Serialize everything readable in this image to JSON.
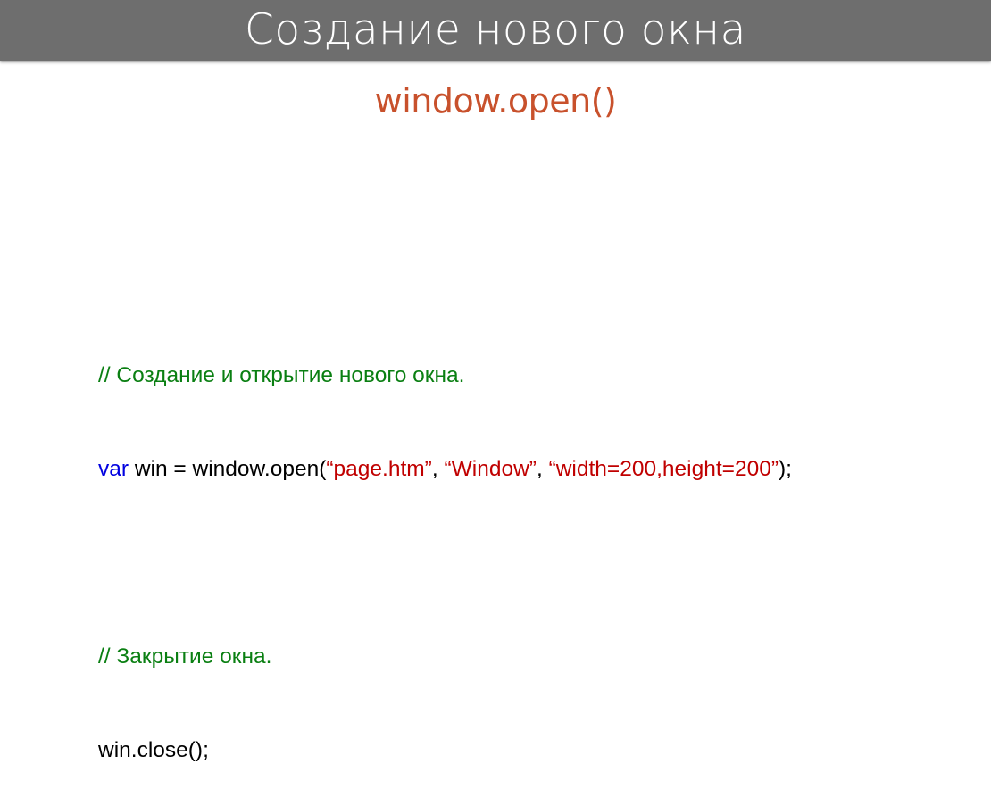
{
  "slide": {
    "title": "Создание нового окна",
    "subtitle": "window.open()"
  },
  "colors": {
    "title_bar_bg": "#6e6e6e",
    "title_text": "#ffffff",
    "subtitle": "#c8512c",
    "comment": "#0a7f12",
    "keyword": "#0000e0",
    "string": "#c00000",
    "plain": "#000000"
  },
  "code": {
    "line1_comment": "// Создание и открытие нового окна.",
    "line2": {
      "keyword": "var",
      "plain1": " win = window.open(",
      "string1": "“page.htm”",
      "plain2": ", ",
      "string2": "“Window”",
      "plain3": ", ",
      "string3": "“width=200,height=200”",
      "plain4": ");"
    },
    "line4_comment": "// Закрытие окна.",
    "line5": "win.close();"
  }
}
